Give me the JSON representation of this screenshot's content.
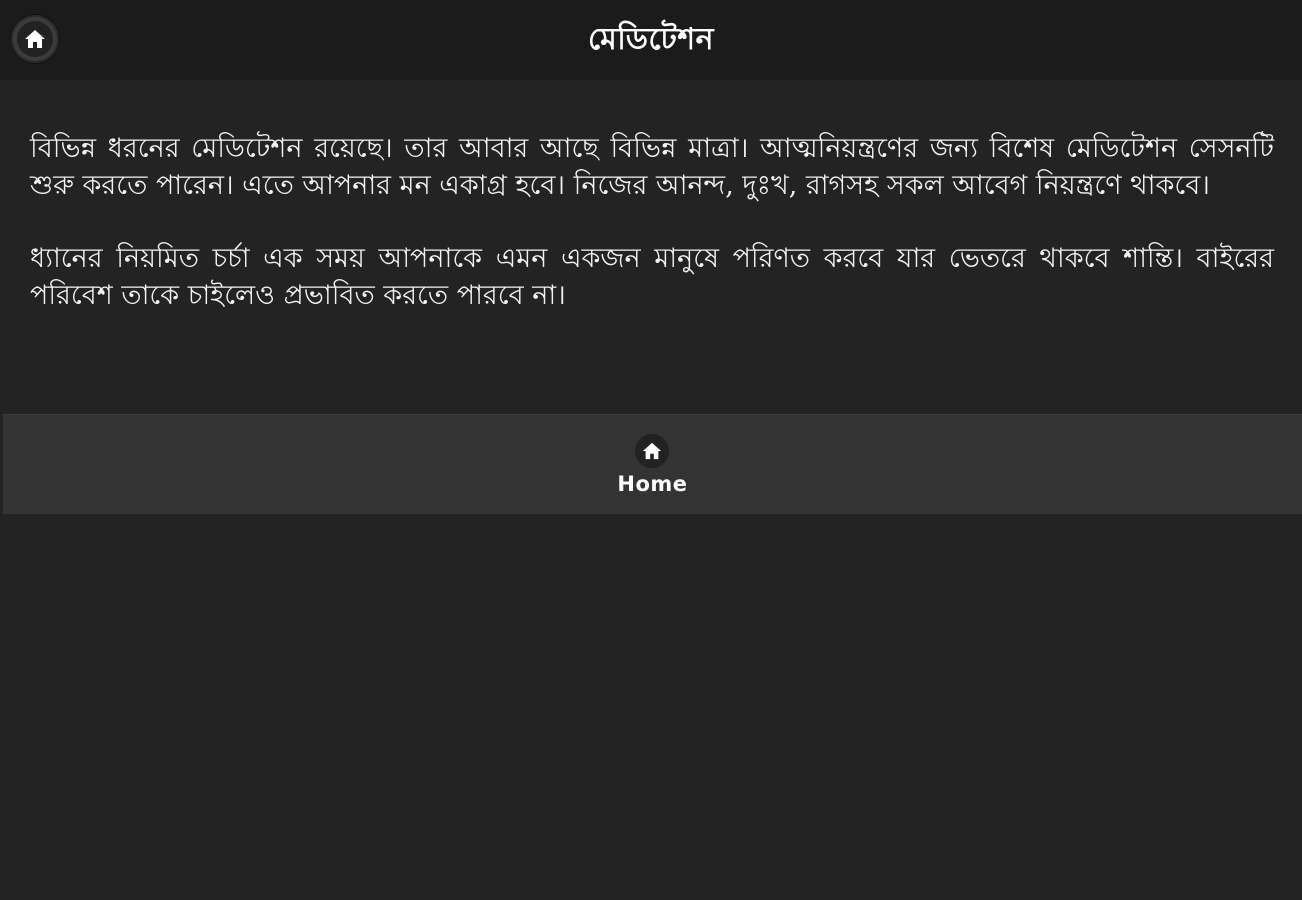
{
  "header": {
    "title": "মেডিটেশন",
    "home_icon": "home-icon"
  },
  "main": {
    "paragraphs": [
      "বিভিন্ন ধরনের মেডিটেশন রয়েছে। তার আবার আছে বিভিন্ন মাত্রা। আত্মনিয়ন্ত্রণের জন্য বিশেষ মেডিটেশন সেসনটি শুরু করতে পারেন। এতে আপনার মন একাগ্র হবে। নিজের আনন্দ, দুঃখ, রাগসহ সকল আবেগ নিয়ন্ত্রণে থাকবে।",
      "ধ্যানের নিয়মিত চর্চা এক সময় আপনাকে এমন একজন মানুষে পরিণত করবে যার ভেতরে থাকবে শান্তি। বাইরের পরিবেশ তাকে চাইলেও প্রভাবিত করতে পারবে না।"
    ]
  },
  "footer": {
    "home_label": "Home",
    "home_icon": "home-icon"
  },
  "colors": {
    "background": "#232323",
    "header": "#1b1b1b",
    "footer": "#333333",
    "text": "#ffffff"
  }
}
